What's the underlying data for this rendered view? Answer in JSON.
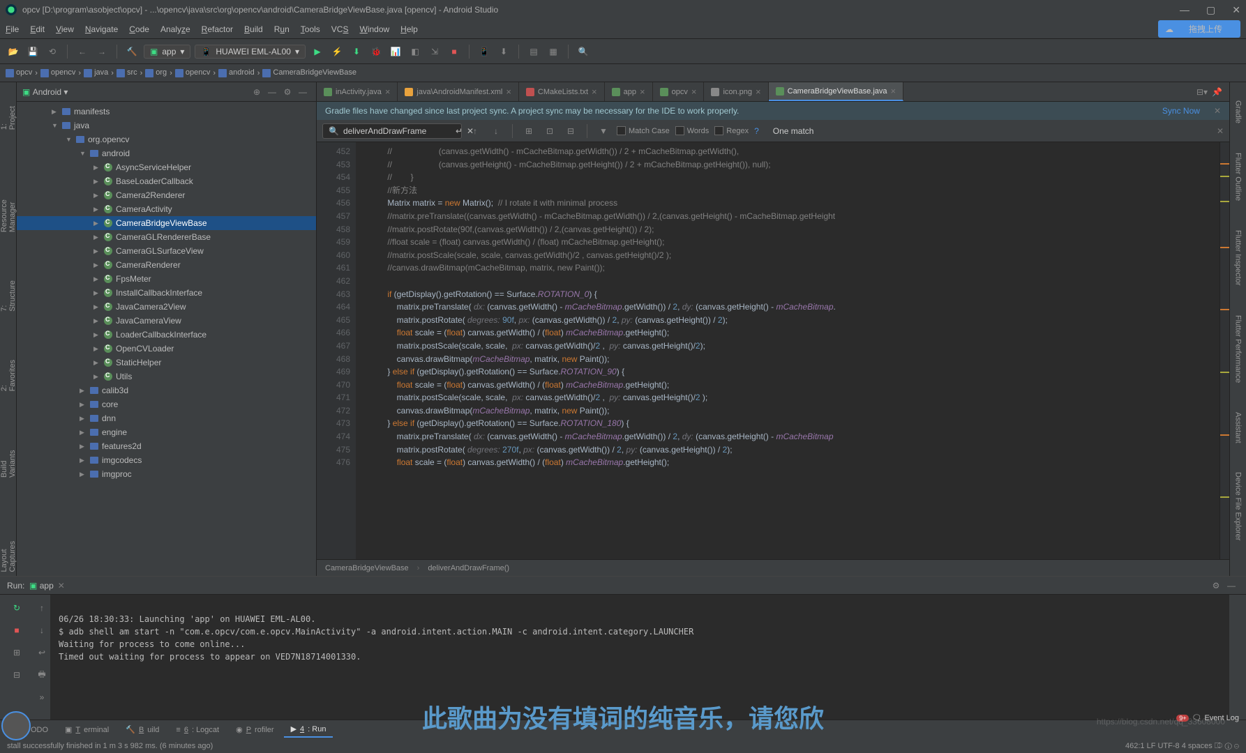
{
  "title": "opcv [D:\\program\\asobject\\opcv] - ...\\opencv\\java\\src\\org\\opencv\\android\\CameraBridgeViewBase.java [opencv] - Android Studio",
  "menu": [
    "File",
    "Edit",
    "View",
    "Navigate",
    "Code",
    "Analyze",
    "Refactor",
    "Build",
    "Run",
    "Tools",
    "VCS",
    "Window",
    "Help"
  ],
  "cloud_btn": "拖拽上传",
  "run_config": "app",
  "device": "HUAWEI EML-AL00",
  "breadcrumb": [
    "opcv",
    "opencv",
    "java",
    "src",
    "org",
    "opencv",
    "android",
    "CameraBridgeViewBase"
  ],
  "left_tabs": [
    "1: Project",
    "Resource Manager",
    "7: Structure",
    "2: Favorites",
    "Build Variants",
    "Layout Captures"
  ],
  "right_tabs": [
    "Gradle",
    "Flutter Outline",
    "Flutter Inspector",
    "Flutter Performance",
    "Assistant",
    "Device File Explorer"
  ],
  "project_header": "Android",
  "tree": [
    {
      "ind": 50,
      "arrow": "▶",
      "icon": "folder",
      "label": "manifests"
    },
    {
      "ind": 50,
      "arrow": "▼",
      "icon": "folder",
      "label": "java"
    },
    {
      "ind": 70,
      "arrow": "▼",
      "icon": "folder",
      "label": "org.opencv"
    },
    {
      "ind": 90,
      "arrow": "▼",
      "icon": "folder",
      "label": "android"
    },
    {
      "ind": 110,
      "arrow": "▶",
      "icon": "class",
      "label": "AsyncServiceHelper"
    },
    {
      "ind": 110,
      "arrow": "▶",
      "icon": "class",
      "label": "BaseLoaderCallback"
    },
    {
      "ind": 110,
      "arrow": "▶",
      "icon": "class",
      "label": "Camera2Renderer"
    },
    {
      "ind": 110,
      "arrow": "▶",
      "icon": "class",
      "label": "CameraActivity"
    },
    {
      "ind": 110,
      "arrow": "▶",
      "icon": "class",
      "label": "CameraBridgeViewBase",
      "sel": true
    },
    {
      "ind": 110,
      "arrow": "▶",
      "icon": "class",
      "label": "CameraGLRendererBase"
    },
    {
      "ind": 110,
      "arrow": "▶",
      "icon": "class",
      "label": "CameraGLSurfaceView"
    },
    {
      "ind": 110,
      "arrow": "▶",
      "icon": "class",
      "label": "CameraRenderer"
    },
    {
      "ind": 110,
      "arrow": "▶",
      "icon": "class",
      "label": "FpsMeter"
    },
    {
      "ind": 110,
      "arrow": "▶",
      "icon": "class",
      "label": "InstallCallbackInterface"
    },
    {
      "ind": 110,
      "arrow": "▶",
      "icon": "class",
      "label": "JavaCamera2View"
    },
    {
      "ind": 110,
      "arrow": "▶",
      "icon": "class",
      "label": "JavaCameraView"
    },
    {
      "ind": 110,
      "arrow": "▶",
      "icon": "class",
      "label": "LoaderCallbackInterface"
    },
    {
      "ind": 110,
      "arrow": "▶",
      "icon": "class",
      "label": "OpenCVLoader"
    },
    {
      "ind": 110,
      "arrow": "▶",
      "icon": "class",
      "label": "StaticHelper"
    },
    {
      "ind": 110,
      "arrow": "▶",
      "icon": "class",
      "label": "Utils"
    },
    {
      "ind": 90,
      "arrow": "▶",
      "icon": "folder",
      "label": "calib3d"
    },
    {
      "ind": 90,
      "arrow": "▶",
      "icon": "folder",
      "label": "core"
    },
    {
      "ind": 90,
      "arrow": "▶",
      "icon": "folder",
      "label": "dnn"
    },
    {
      "ind": 90,
      "arrow": "▶",
      "icon": "folder",
      "label": "engine"
    },
    {
      "ind": 90,
      "arrow": "▶",
      "icon": "folder",
      "label": "features2d"
    },
    {
      "ind": 90,
      "arrow": "▶",
      "icon": "folder",
      "label": "imgcodecs"
    },
    {
      "ind": 90,
      "arrow": "▶",
      "icon": "folder",
      "label": "imgproc"
    }
  ],
  "tabs": [
    {
      "label": "inActivity.java",
      "icon": "class"
    },
    {
      "label": "java\\AndroidManifest.xml",
      "icon": "xml"
    },
    {
      "label": "CMakeLists.txt",
      "icon": "cmake"
    },
    {
      "label": "app",
      "icon": "gradle"
    },
    {
      "label": "opcv",
      "icon": "gradle"
    },
    {
      "label": "icon.png",
      "icon": "img"
    },
    {
      "label": "CameraBridgeViewBase.java",
      "icon": "class",
      "active": true
    }
  ],
  "sync_msg": "Gradle files have changed since last project sync. A project sync may be necessary for the IDE to work properly.",
  "sync_link": "Sync Now",
  "find": {
    "value": "deliverAndDrawFrame",
    "match_case": "Match Case",
    "words": "Words",
    "regex": "Regex",
    "result": "One match"
  },
  "line_start": 452,
  "code_crumb": [
    "CameraBridgeViewBase",
    "deliverAndDrawFrame()"
  ],
  "run_panel": {
    "title": "Run:",
    "tab": "app"
  },
  "console": [
    "",
    "06/26 18:30:33: Launching 'app' on HUAWEI EML-AL00.",
    "$ adb shell am start -n \"com.e.opcv/com.e.opcv.MainActivity\" -a android.intent.action.MAIN -c android.intent.category.LAUNCHER",
    "Waiting for process to come online...",
    "Timed out waiting for process to appear on VED7N18714001330."
  ],
  "bottom_tabs": [
    {
      "label": "TODO",
      "icon": "✓"
    },
    {
      "label": "Terminal",
      "icon": "▣"
    },
    {
      "label": "Build",
      "icon": "🔨"
    },
    {
      "label": "6: Logcat",
      "icon": "≡"
    },
    {
      "label": "Profiler",
      "icon": "◉"
    },
    {
      "label": "4: Run",
      "icon": "▶",
      "active": true
    }
  ],
  "event_log": "Event Log",
  "event_badge": "9+",
  "status": "stall successfully finished in 1 m 3 s 982 ms. (6 minutes ago)",
  "status_right": "462:1   LF   UTF-8   4 spaces   ⎄  ⓘ  ⊝",
  "overlay": "此歌曲为没有填词的纯音乐，请您欣",
  "watermark": "https://blog.csdn.net/qq_33608000"
}
